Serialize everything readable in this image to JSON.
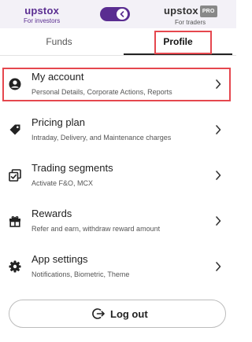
{
  "header": {
    "left_brand": "upstox",
    "left_caption": "For investors",
    "right_brand": "upstox",
    "right_badge": "PRO",
    "right_caption": "For traders"
  },
  "tabs": [
    {
      "label": "Funds",
      "active": false
    },
    {
      "label": "Profile",
      "active": true
    }
  ],
  "menu": [
    {
      "title": "My account",
      "subtitle": "Personal Details, Corporate Actions, Reports",
      "icon": "user-icon"
    },
    {
      "title": "Pricing plan",
      "subtitle": "Intraday, Delivery, and Maintenance charges",
      "icon": "tag-icon"
    },
    {
      "title": "Trading segments",
      "subtitle": "Activate F&O, MCX",
      "icon": "segments-icon"
    },
    {
      "title": "Rewards",
      "subtitle": "Refer and earn, withdraw reward amount",
      "icon": "gift-icon"
    },
    {
      "title": "App settings",
      "subtitle": "Notifications, Biometric, Theme",
      "icon": "gear-icon"
    }
  ],
  "logout": {
    "label": "Log out",
    "icon": "logout-icon"
  },
  "colors": {
    "brand": "#5a2d91",
    "highlight": "#e5474e"
  }
}
